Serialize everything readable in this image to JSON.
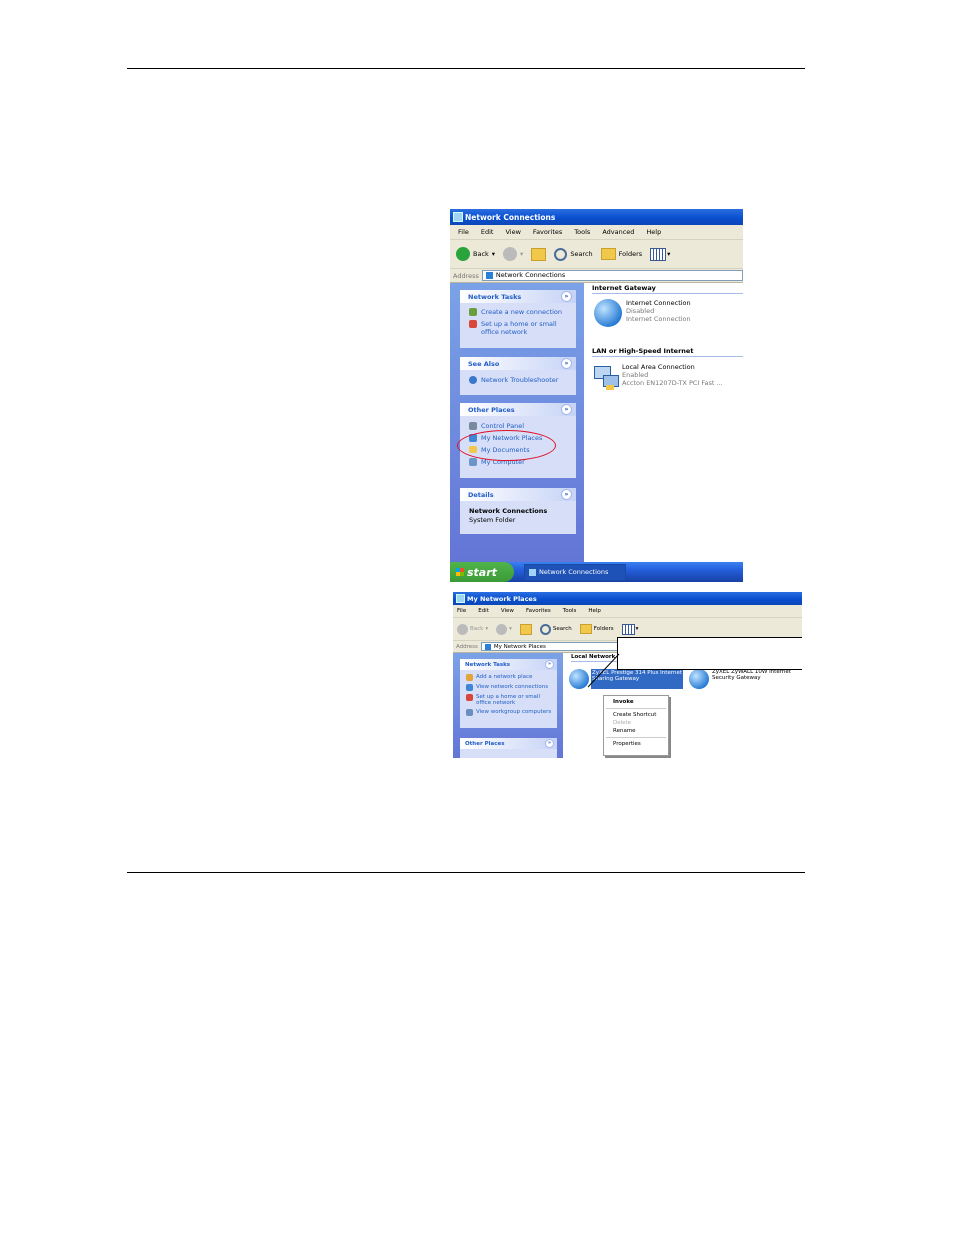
{
  "shot1": {
    "title": "Network Connections",
    "menu": [
      "File",
      "Edit",
      "View",
      "Favorites",
      "Tools",
      "Advanced",
      "Help"
    ],
    "toolbar": {
      "back": "Back",
      "search": "Search",
      "folders": "Folders"
    },
    "address": {
      "label": "Address",
      "value": "Network Connections"
    },
    "network_tasks": {
      "title": "Network Tasks",
      "items": [
        "Create a new connection",
        "Set up a home or small",
        "office network"
      ]
    },
    "see_also": {
      "title": "See Also",
      "items": [
        "Network Troubleshooter"
      ]
    },
    "other_places": {
      "title": "Other Places",
      "items": [
        "Control Panel",
        "My Network Places",
        "My Documents",
        "My Computer"
      ]
    },
    "details": {
      "title": "Details",
      "name": "Network Connections",
      "type": "System Folder"
    },
    "groups": [
      {
        "title": "Internet Gateway",
        "item": {
          "name": "Internet Connection",
          "status": "Disabled",
          "desc": "Internet Connection"
        }
      },
      {
        "title": "LAN or High-Speed Internet",
        "item": {
          "name": "Local Area Connection",
          "status": "Enabled",
          "desc": "Accton EN1207D-TX PCI Fast ..."
        }
      }
    ],
    "taskbar": {
      "start": "start",
      "task": "Network Connections"
    }
  },
  "shot2": {
    "title": "My Network Places",
    "menu": [
      "File",
      "Edit",
      "View",
      "Favorites",
      "Tools",
      "Help"
    ],
    "toolbar": {
      "back": "Back",
      "search": "Search",
      "folders": "Folders"
    },
    "address": {
      "label": "Address",
      "value": "My Network Places"
    },
    "network_tasks": {
      "title": "Network Tasks",
      "items": [
        "Add a network place",
        "View network connections",
        "Set up a home or small",
        "office network",
        "View workgroup computers"
      ]
    },
    "other_places": {
      "title": "Other Places"
    },
    "group": "Local Network",
    "devices": [
      {
        "line1": "ZyXEL Prestige 314 Plus Internet",
        "line2": "Sharing Gateway"
      },
      {
        "line1": "ZyXEL ZyWALL 10W Internet",
        "line2": "Security Gateway"
      }
    ],
    "context_menu": {
      "invoke": "Invoke",
      "create_shortcut": "Create Shortcut",
      "delete": "Delete",
      "rename": "Rename",
      "properties": "Properties"
    }
  },
  "colors": {
    "xp_blue": "#0a4fd0",
    "task_pane": "#6375d6",
    "highlight_red": "#e0102a",
    "selection": "#316ac5"
  }
}
